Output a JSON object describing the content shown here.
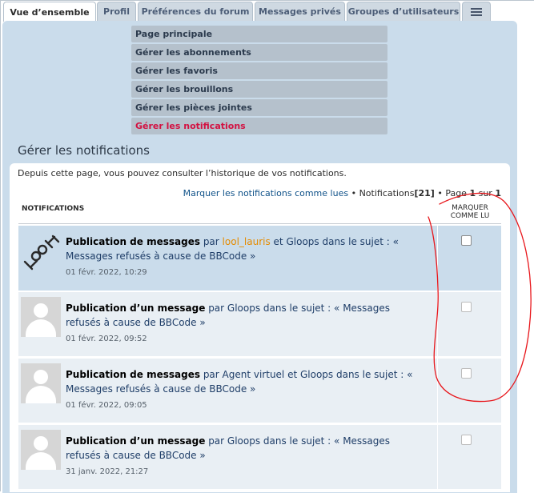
{
  "tabs": [
    {
      "label": "Vue d’ensemble",
      "active": true
    },
    {
      "label": "Profil"
    },
    {
      "label": "Préférences du forum"
    },
    {
      "label": "Messages privés"
    },
    {
      "label": "Groupes d’utilisateurs"
    }
  ],
  "submenu": [
    {
      "label": "Page principale"
    },
    {
      "label": "Gérer les abonnements"
    },
    {
      "label": "Gérer les favoris"
    },
    {
      "label": "Gérer les brouillons"
    },
    {
      "label": "Gérer les pièces jointes"
    },
    {
      "label": "Gérer les notifications",
      "active": true
    }
  ],
  "page_title": "Gérer les notifications",
  "intro": "Depuis cette page, vous pouvez consulter l’historique de vos notifications.",
  "pagination": {
    "mark_all": "Marquer les notifications comme lues",
    "sep1": "•",
    "count_label": "Notifications",
    "count": "[21]",
    "sep2": "•",
    "page_label": "Page",
    "page_current": "1",
    "page_of": "sur",
    "page_total": "1"
  },
  "columns": {
    "notifications": "NOTIFICATIONS",
    "mark_read": "MARQUER COMME LU"
  },
  "notifications": [
    {
      "title": "Publication de messages",
      "by": "par",
      "user1": "lool_lauris",
      "and": "et",
      "user2": "Gloops",
      "in_topic": "dans le sujet :",
      "topic": "« Messages refusés à cause de BBCode »",
      "time": "01 févr. 2022, 10:29"
    },
    {
      "title": "Publication d’un message",
      "rest": "par Gloops dans le sujet : « Messages refusés à cause de BBCode »",
      "time": "01 févr. 2022, 09:52"
    },
    {
      "title": "Publication de messages",
      "rest": "par Agent virtuel et Gloops dans le sujet : « Messages refusés à cause de BBCode »",
      "time": "01 févr. 2022, 09:05"
    },
    {
      "title": "Publication d’un message",
      "rest": "par Gloops dans le sujet : « Messages refusés à cause de BBCode »",
      "time": "31 janv. 2022, 21:27"
    }
  ],
  "colors": {
    "accent_red": "#d31141",
    "link_blue": "#105289",
    "panel_bg": "#cadceb",
    "username_orange": "#e58b00",
    "annotation_red": "#e8161b"
  },
  "icons": {
    "menu": "hamburger-icon",
    "avatar_default": "default-avatar-icon",
    "avatar_logo": "loop-logo-icon"
  }
}
